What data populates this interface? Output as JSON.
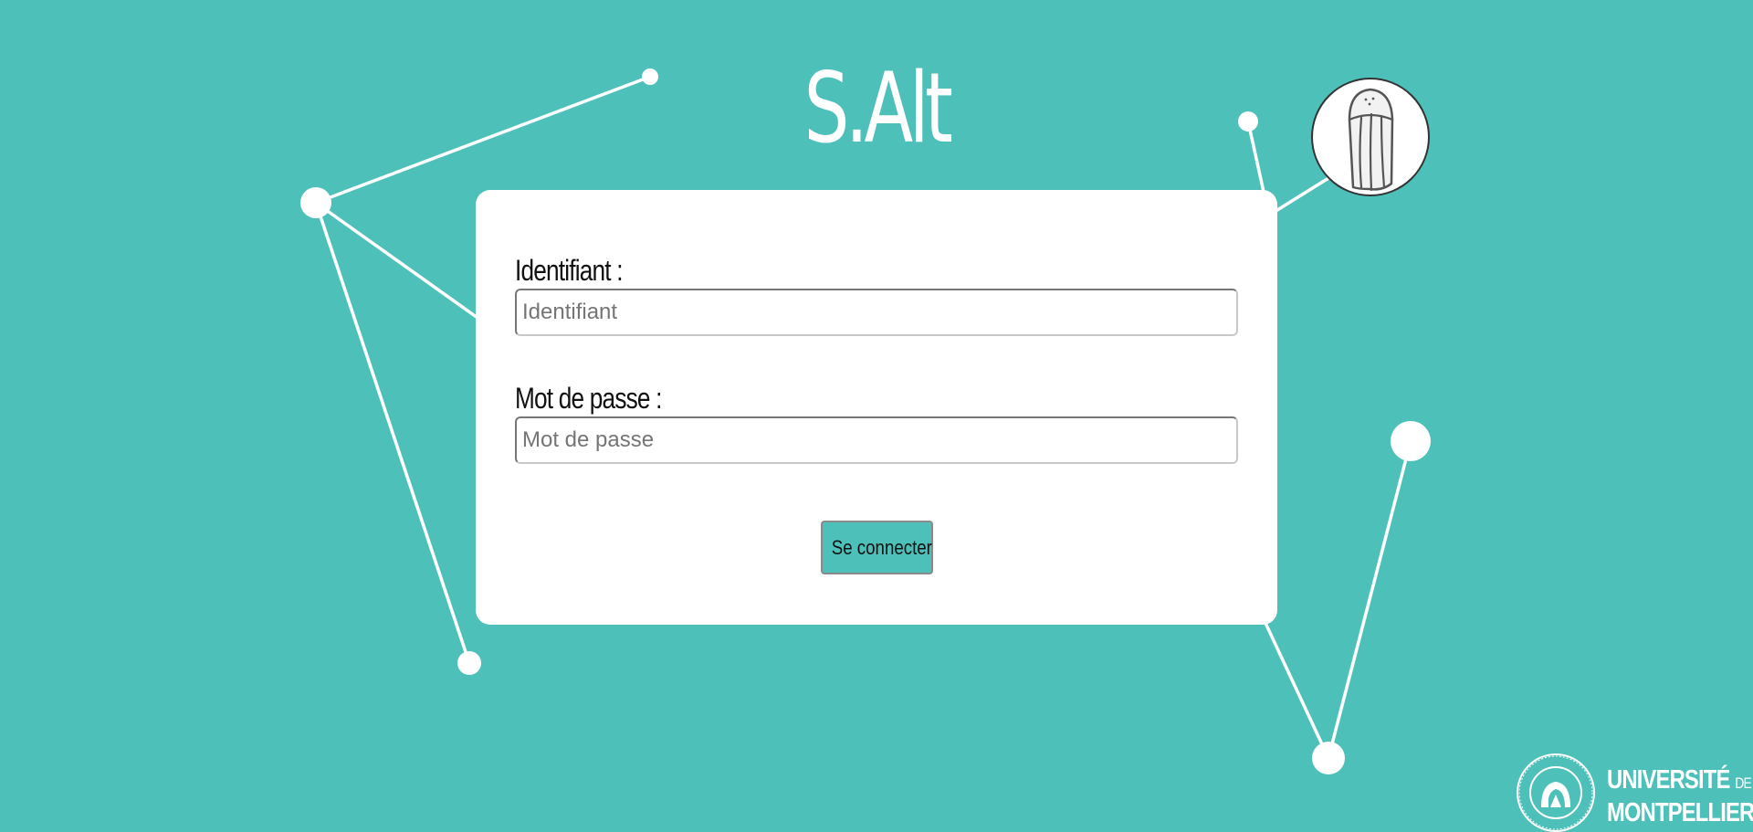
{
  "app": {
    "title": "S.Alt"
  },
  "login_form": {
    "username": {
      "label": "Identifiant :",
      "placeholder": "Identifiant",
      "value": ""
    },
    "password": {
      "label": "Mot de passe :",
      "placeholder": "Mot de passe",
      "value": ""
    },
    "submit_label": "Se connecter"
  },
  "footer": {
    "university_line1": "UNIVERSITÉ",
    "university_de": "DE",
    "university_line2": "MONTPELLIER",
    "seal_text": "L'AVENIR DEPUIS 1289"
  },
  "icons": {
    "logo": "salt-shaker-icon",
    "university": "university-seal-icon"
  },
  "colors": {
    "background": "#4ec0ba",
    "card": "#ffffff",
    "button": "#4ec0ba",
    "decoration": "#ffffff"
  }
}
